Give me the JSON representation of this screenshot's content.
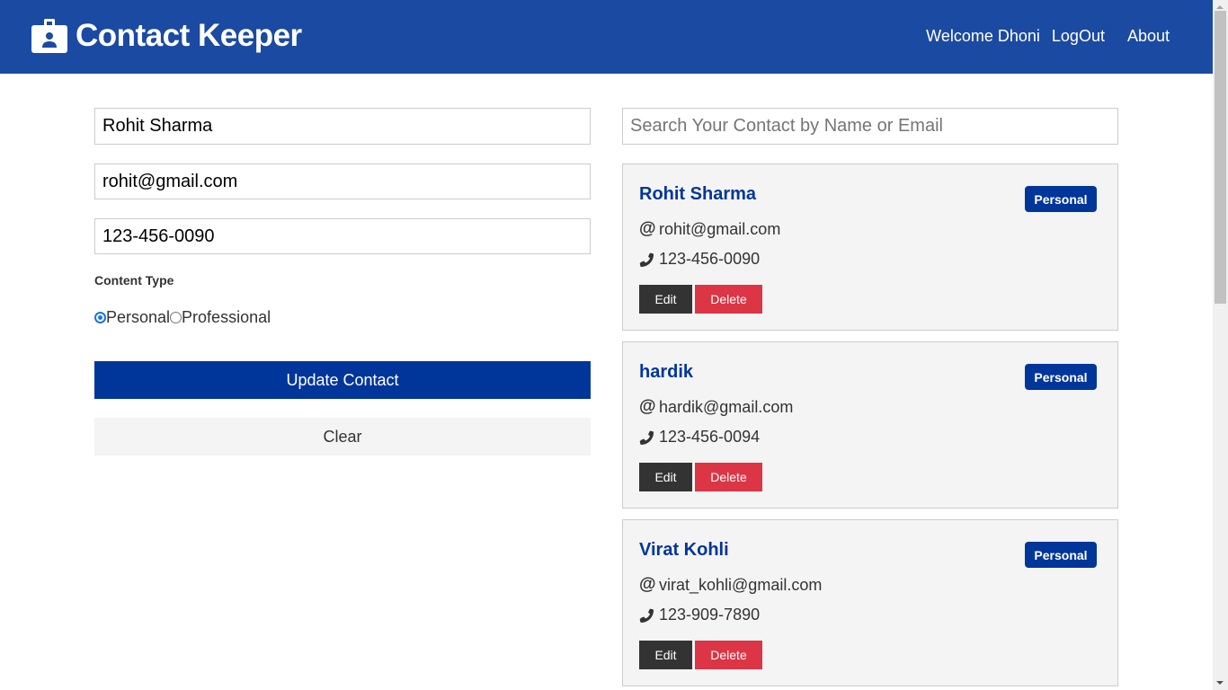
{
  "navbar": {
    "brand_icon": "id-badge-icon",
    "title": "Contact Keeper",
    "welcome": "Welcome Dhoni",
    "logout": "LogOut",
    "about": "About",
    "background": "#1b4aa2"
  },
  "form": {
    "name_value": "Rohit Sharma",
    "email_value": "rohit@gmail.com",
    "phone_value": "123-456-0090",
    "type_label": "Content Type",
    "radio_personal": "Personal",
    "radio_professional": "Professional",
    "selected_type": "personal",
    "submit_label": "Update Contact",
    "clear_label": "Clear"
  },
  "search": {
    "placeholder": "Search Your Contact by Name or Email",
    "value": ""
  },
  "contacts": [
    {
      "name": "Rohit Sharma",
      "type": "Personal",
      "email": "rohit@gmail.com",
      "phone": "123-456-0090",
      "edit": "Edit",
      "delete": "Delete"
    },
    {
      "name": "hardik",
      "type": "Personal",
      "email": "hardik@gmail.com",
      "phone": "123-456-0094",
      "edit": "Edit",
      "delete": "Delete"
    },
    {
      "name": "Virat Kohli",
      "type": "Personal",
      "email": "virat_kohli@gmail.com",
      "phone": "123-909-7890",
      "edit": "Edit",
      "delete": "Delete"
    }
  ],
  "colors": {
    "primary": "#003699",
    "danger": "#dc3545",
    "dark": "#333333",
    "light": "#f4f4f4"
  }
}
